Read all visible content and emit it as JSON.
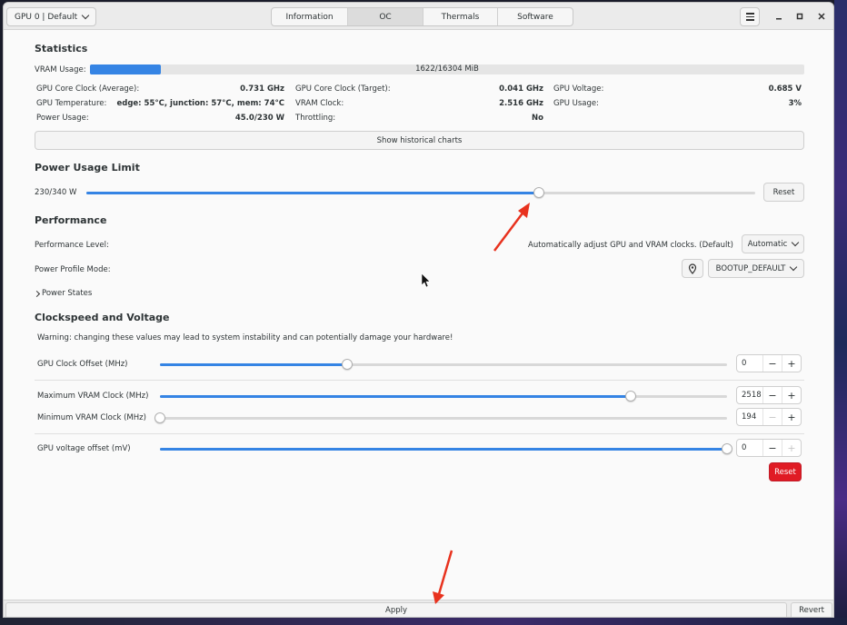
{
  "header": {
    "gpu_select": "GPU 0 | Default",
    "tabs": [
      "Information",
      "OC",
      "Thermals",
      "Software"
    ],
    "active_tab": "OC"
  },
  "statistics": {
    "title": "Statistics",
    "vram_usage_label": "VRAM Usage:",
    "vram_usage_value": "1622/16304 MiB",
    "vram_used_fraction": 0.0995,
    "rows": [
      [
        {
          "label": "GPU Core Clock (Average):",
          "value": "0.731 GHz"
        },
        {
          "label": "GPU Core Clock (Target):",
          "value": "0.041 GHz"
        },
        {
          "label": "GPU Voltage:",
          "value": "0.685 V"
        }
      ],
      [
        {
          "label": "GPU Temperature:",
          "value": "edge: 55°C, junction: 57°C, mem: 74°C"
        },
        {
          "label": "VRAM Clock:",
          "value": "2.516 GHz"
        },
        {
          "label": "GPU Usage:",
          "value": "3%"
        }
      ],
      [
        {
          "label": "Power Usage:",
          "value": "45.0/230 W"
        },
        {
          "label": "Throttling:",
          "value": "No"
        }
      ]
    ],
    "historical_button": "Show historical charts"
  },
  "power_limit": {
    "title": "Power Usage Limit",
    "value_label": "230/340 W",
    "value": 230,
    "max": 340,
    "reset_label": "Reset"
  },
  "performance": {
    "title": "Performance",
    "level_label": "Performance Level:",
    "level_description": "Automatically adjust GPU and VRAM clocks. (Default)",
    "level_select": "Automatic",
    "profile_label": "Power Profile Mode:",
    "profile_select": "BOOTUP_DEFAULT",
    "power_states_label": "Power States"
  },
  "clockspeed": {
    "title": "Clockspeed and Voltage",
    "warning": "Warning: changing these values may lead to system instability and can potentially damage your hardware!",
    "gpu_clock_offset": {
      "label": "GPU Clock Offset (MHz)",
      "value": "0",
      "fraction": 0.33
    },
    "max_vram_clock": {
      "label": "Maximum VRAM Clock (MHz)",
      "value": "2518",
      "fraction": 0.83
    },
    "min_vram_clock": {
      "label": "Minimum VRAM Clock (MHz)",
      "value": "194",
      "fraction": 0.0
    },
    "voltage_offset": {
      "label": "GPU voltage offset (mV)",
      "value": "0",
      "fraction": 1.0
    },
    "minus": "−",
    "plus": "+",
    "reset_label": "Reset"
  },
  "footer": {
    "apply_label": "Apply",
    "revert_label": "Revert"
  },
  "colors": {
    "accent": "#3584e4",
    "destructive": "#e01b24",
    "annotation_arrow": "#e8321e"
  }
}
